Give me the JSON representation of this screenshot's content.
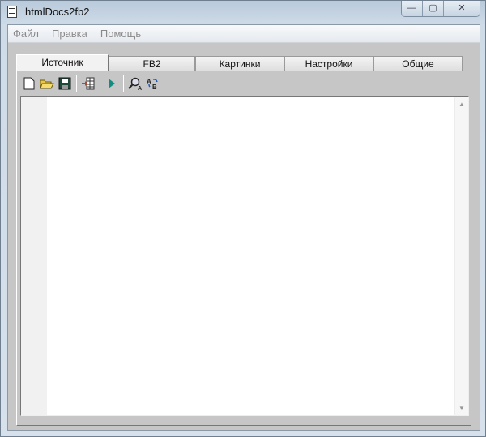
{
  "window": {
    "title": "htmlDocs2fb2",
    "minimize": "—",
    "maximize": "▢",
    "close": "✕"
  },
  "menu": [
    "Файл",
    "Правка",
    "Помощь"
  ],
  "tabs": [
    {
      "label": "Источник",
      "active": true
    },
    {
      "label": "FB2"
    },
    {
      "label": "Картинки"
    },
    {
      "label": "Настройки"
    },
    {
      "label": "Общие"
    }
  ],
  "toolbar": [
    "new-file-icon",
    "open-folder-icon",
    "save-icon",
    "import-table-icon",
    "run-icon",
    "find-icon",
    "replace-icon"
  ],
  "scroll": {
    "up": "▲",
    "down": "▼"
  }
}
